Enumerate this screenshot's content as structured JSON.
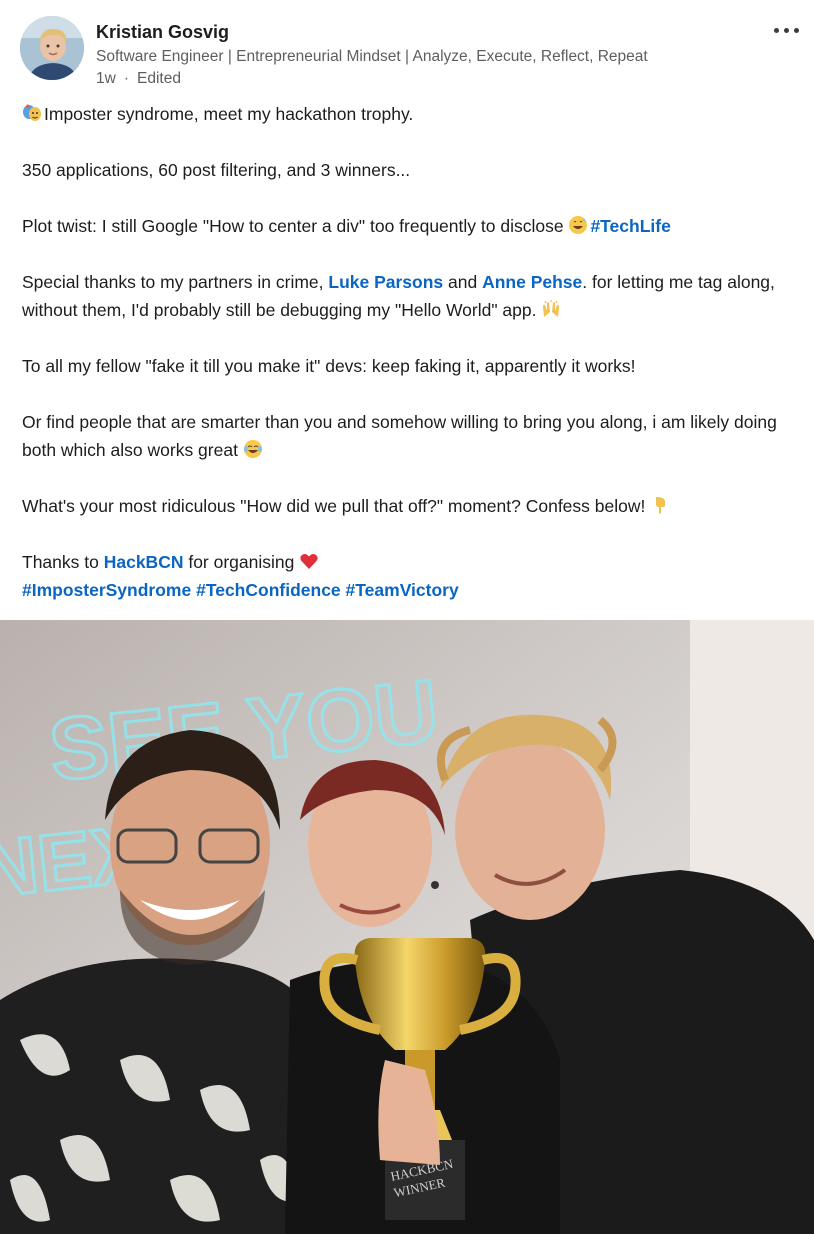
{
  "author": {
    "name": "Kristian Gosvig",
    "headline": "Software Engineer | Entrepreneurial Mindset | Analyze, Execute, Reflect, Repeat",
    "time": "1w",
    "separator": "·",
    "edited": "Edited"
  },
  "post": {
    "line1": "Imposter syndrome, meet my hackathon trophy.",
    "line2": "350 applications, 60 post filtering, and 3 winners...",
    "line3_text": "Plot twist: I still Google \"How to center a div\" too frequently to disclose ",
    "line3_tag": "#TechLife",
    "line4_a": "Special thanks to my partners in crime, ",
    "mention1": "Luke Parsons",
    "line4_b": " and ",
    "mention2": "Anne Pehse",
    "line4_c": ". for letting me tag along, without them, I'd probably still be debugging my \"Hello World\" app. ",
    "line5": "To all my fellow \"fake it till you make it\" devs: keep faking it, apparently it works!",
    "line6": "Or find people that are smarter than you and somehow willing to bring you along, i am likely doing both which also works great ",
    "line7": "What's your most ridiculous \"How did we pull that off?\" moment? Confess below! ",
    "line8_a": "Thanks to ",
    "line8_link": "HackBCN",
    "line8_b": " for organising ",
    "hashtags": [
      "#ImposterSyndrome",
      "#TechConfidence",
      "#TeamVictory"
    ]
  },
  "photo": {
    "sign_text_top": "SEE YOU",
    "sign_text_bottom": "NEXT",
    "trophy_text_1": "HACKBCN",
    "trophy_text_2": "WINNER"
  },
  "icons": {
    "more": "more-options-icon",
    "emoji_masks": "performing-arts-emoji",
    "emoji_sweat": "grinning-sweat-emoji",
    "emoji_hands": "raising-hands-emoji",
    "emoji_laugh": "tears-of-joy-emoji",
    "emoji_point": "pointing-down-emoji",
    "emoji_heart": "red-heart-emoji"
  },
  "colors": {
    "link": "#0a66c2",
    "text": "#1d1d1d",
    "muted": "#5e5e5e"
  }
}
